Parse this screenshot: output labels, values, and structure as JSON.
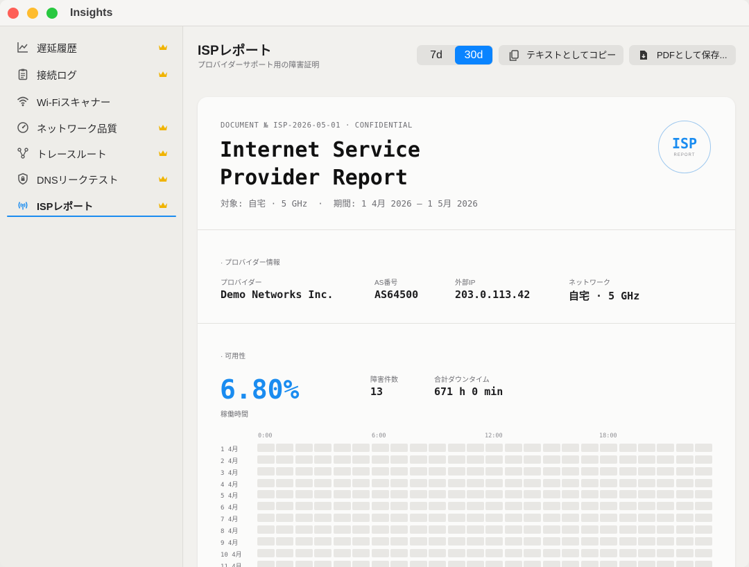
{
  "window": {
    "title": "Insights"
  },
  "sidebar": {
    "items": [
      {
        "label": "遅延履歴",
        "icon": "chart-line-icon",
        "premium": true
      },
      {
        "label": "接続ログ",
        "icon": "clipboard-icon",
        "premium": true
      },
      {
        "label": "Wi-Fiスキャナー",
        "icon": "wifi-icon",
        "premium": false
      },
      {
        "label": "ネットワーク品質",
        "icon": "gauge-icon",
        "premium": true
      },
      {
        "label": "トレースルート",
        "icon": "route-nodes-icon",
        "premium": true
      },
      {
        "label": "DNSリークテスト",
        "icon": "shield-lock-icon",
        "premium": true
      },
      {
        "label": "ISPレポート",
        "icon": "antenna-icon",
        "premium": true,
        "active": true
      }
    ]
  },
  "header": {
    "title": "ISPレポート",
    "subtitle": "プロバイダーサポート用の障害証明",
    "range": {
      "options": [
        "7d",
        "30d"
      ],
      "selected": "30d"
    },
    "copy_text_label": "テキストとしてコピー",
    "save_pdf_label": "PDFとして保存..."
  },
  "report": {
    "doc_number": "DOCUMENT № ISP-2026-05-01 · CONFIDENTIAL",
    "title": "Internet Service Provider Report",
    "meta": "対象: 自宅 · 5 GHz  ·  期間: 1 4月 2026 — 1 5月 2026",
    "stamp": {
      "main": "ISP",
      "sub": "REPORT"
    },
    "provider_section": {
      "heading": "· プロバイダー情報",
      "fields": [
        {
          "label": "プロバイダー",
          "value": "Demo Networks Inc."
        },
        {
          "label": "AS番号",
          "value": "AS64500"
        },
        {
          "label": "外部IP",
          "value": "203.0.113.42"
        },
        {
          "label": "ネットワーク",
          "value": "自宅 · 5 GHz"
        }
      ]
    },
    "availability_section": {
      "heading": "· 可用性",
      "uptime_value": "6.80%",
      "uptime_label": "稼働時間",
      "incidents_label": "障害件数",
      "incidents_value": "13",
      "downtime_label": "合計ダウンタイム",
      "downtime_value": "671 h 0 min",
      "heatmap": {
        "hour_labels": [
          "0:00",
          "6:00",
          "12:00",
          "18:00"
        ],
        "day_labels": [
          "1 4月",
          "2 4月",
          "3 4月",
          "4 4月",
          "5 4月",
          "6 4月",
          "7 4月",
          "8 4月",
          "9 4月",
          "10 4月",
          "11 4月"
        ],
        "cells_per_row": 24,
        "cell_color": "#e8e7e4"
      }
    }
  },
  "colors": {
    "accent": "#0a84ff",
    "premium_crown": "#f0b400"
  }
}
